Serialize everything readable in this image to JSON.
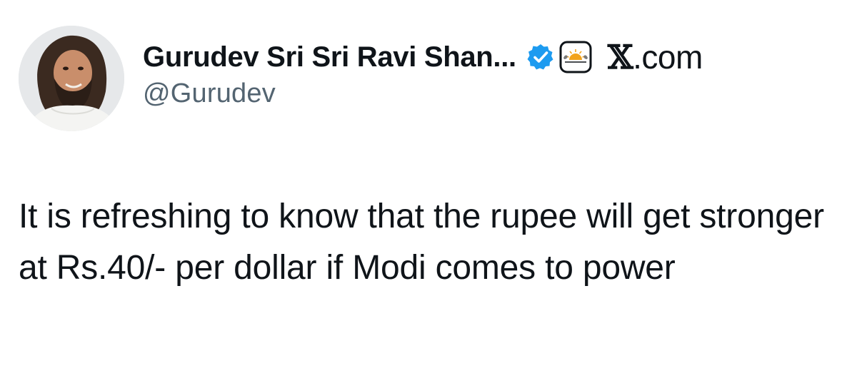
{
  "author": {
    "display_name": "Gurudev Sri Sri Ravi Shan...",
    "handle": "@Gurudev",
    "avatar_icon": "profile-photo"
  },
  "badges": {
    "verified_icon": "verified-checkmark-icon",
    "verified_color": "#1d9bf0",
    "affiliate_icon": "organization-affiliate-icon"
  },
  "source": {
    "label_prefix": "𝕏",
    "label_suffix": ".com"
  },
  "tweet": {
    "text": "It is refreshing to know that the rupee will get stronger at Rs.40/- per dollar if Modi comes to power"
  },
  "colors": {
    "text_primary": "#0f1419",
    "text_secondary": "#536471",
    "background": "#ffffff"
  }
}
